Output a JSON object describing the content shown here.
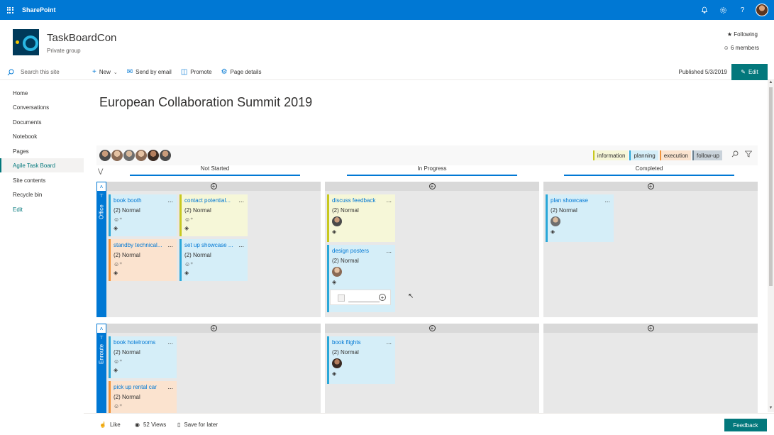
{
  "suitebar": {
    "app_name": "SharePoint"
  },
  "site": {
    "title": "TaskBoardCon",
    "subtitle": "Private group",
    "following": "★ Following",
    "members": "6 members"
  },
  "command_bar": {
    "search_placeholder": "Search this site",
    "new_label": "New",
    "send_email_label": "Send by email",
    "promote_label": "Promote",
    "page_details_label": "Page details",
    "published": "Published 5/3/2019",
    "edit_label": "Edit"
  },
  "nav": {
    "items": [
      {
        "label": "Home"
      },
      {
        "label": "Conversations"
      },
      {
        "label": "Documents"
      },
      {
        "label": "Notebook"
      },
      {
        "label": "Pages"
      },
      {
        "label": "Agile Task Board"
      },
      {
        "label": "Site contents"
      },
      {
        "label": "Recycle bin"
      },
      {
        "label": "Edit"
      }
    ]
  },
  "page": {
    "title": "European Collaboration Summit 2019"
  },
  "board": {
    "tags": [
      "information",
      "planning",
      "execution",
      "follow-up"
    ],
    "columns": [
      "Not Started",
      "In Progress",
      "Completed"
    ],
    "lanes": [
      {
        "name": "Office"
      },
      {
        "name": "Enroute"
      }
    ],
    "cards": [
      {
        "title": "book booth",
        "priority": "(2) Normal",
        "color": "#2aa7d8"
      },
      {
        "title": "contact potential...",
        "priority": "(2) Normal",
        "color": "#c8c820"
      },
      {
        "title": "standby technical...",
        "priority": "(2) Normal",
        "color": "#f0923a"
      },
      {
        "title": "set up showcase ...",
        "priority": "(2) Normal",
        "color": "#2aa7d8"
      },
      {
        "title": "discuss feedback",
        "priority": "(2) Normal",
        "color": "#c8c820"
      },
      {
        "title": "design posters",
        "priority": "(2) Normal",
        "color": "#2aa7d8"
      },
      {
        "title": "plan showcase",
        "priority": "(2) Normal",
        "color": "#2aa7d8"
      },
      {
        "title": "book hotelrooms",
        "priority": "(2) Normal",
        "color": "#2aa7d8"
      },
      {
        "title": "pick up rental car",
        "priority": "(2) Normal",
        "color": "#f0923a"
      },
      {
        "title": "book flights",
        "priority": "(2) Normal",
        "color": "#2aa7d8"
      }
    ],
    "more_glyph": "..."
  },
  "footer": {
    "like": "Like",
    "views": "52 Views",
    "save": "Save for later",
    "feedback": "Feedback"
  }
}
